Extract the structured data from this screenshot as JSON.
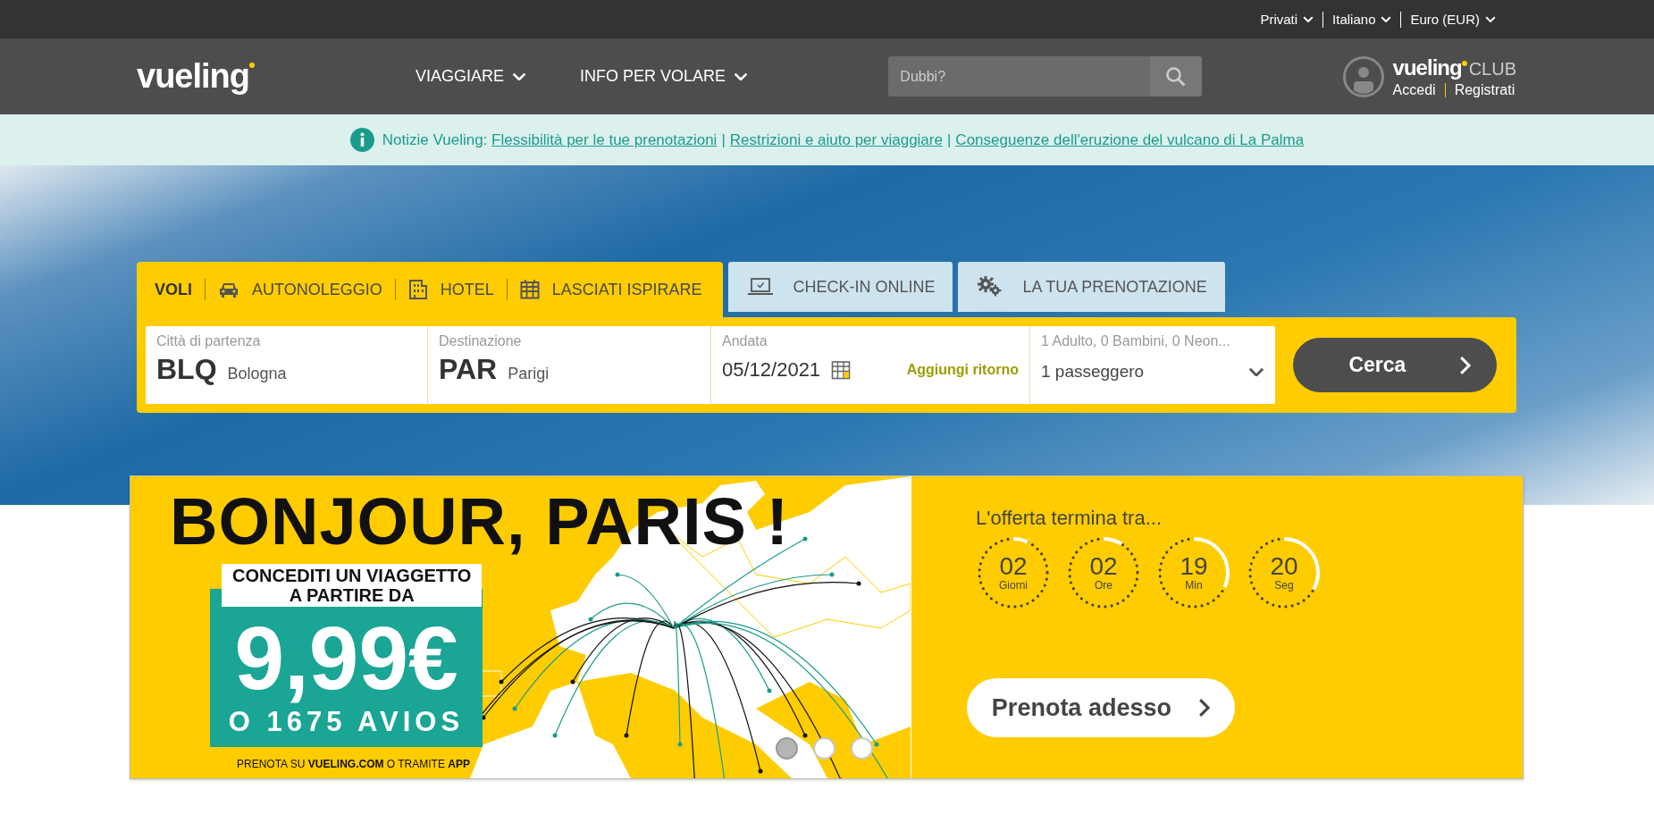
{
  "top_bar": {
    "items": [
      "Privati",
      "Italiano",
      "Euro (EUR)"
    ]
  },
  "header": {
    "logo": "vueling",
    "nav": [
      "VIAGGIARE",
      "INFO PER VOLARE"
    ],
    "search": {
      "placeholder": "Dubbi?"
    },
    "club": {
      "logo": "vueling",
      "label": "CLUB",
      "links": [
        "Accedi",
        "Registrati"
      ]
    }
  },
  "news": {
    "label": "Notizie Vueling:",
    "separator": "|",
    "links": [
      "Flessibilità per le tue prenotazioni",
      "Restrizioni e aiuto per viaggiare",
      "Conseguenze dell'eruzione del vulcano di La Palma"
    ]
  },
  "booking": {
    "tabs": [
      {
        "label": "VOLI",
        "kind": "product",
        "selected": true
      },
      {
        "label": "AUTONOLEGGIO",
        "kind": "product",
        "selected": false
      },
      {
        "label": "HOTEL",
        "kind": "product",
        "selected": false
      },
      {
        "label": "LASCIATI ISPIRARE",
        "kind": "product",
        "selected": false
      },
      {
        "label": "CHECK-IN ONLINE",
        "kind": "manage",
        "selected": false
      },
      {
        "label": "LA TUA PRENOTAZIONE",
        "kind": "manage",
        "selected": false
      }
    ],
    "origin": {
      "label": "Città di partenza",
      "code": "BLQ",
      "city": "Bologna"
    },
    "destination": {
      "label": "Destinazione",
      "code": "PAR",
      "city": "Parigi"
    },
    "departure": {
      "label": "Andata",
      "value": "05/12/2021"
    },
    "add_return": "Aggiungi ritorno",
    "passengers": {
      "label": "1 Adulto, 0 Bambini, 0 Neon...",
      "value": "1 passeggero"
    },
    "search_button": "Cerca"
  },
  "promo": {
    "headline": "BONJOUR, PARIS !",
    "subline": [
      "CONCEDITI UN VIAGGETTO",
      "A PARTIRE DA"
    ],
    "price": "9,99€",
    "avios": "O 1675 AVIOS",
    "footer": "PRENOTA SU **VUELING.COM** O TRAMITE **APP**",
    "carousel": [
      {
        "selected": true
      },
      {
        "selected": false
      },
      {
        "selected": false
      }
    ],
    "countdown": {
      "title": "L'offerta termina tra...",
      "units": [
        {
          "value": "02",
          "label": "Giorni",
          "level": 0.07
        },
        {
          "value": "02",
          "label": "Ore",
          "level": 0.09
        },
        {
          "value": "19",
          "label": "Min",
          "level": 0.32
        },
        {
          "value": "20",
          "label": "Seg",
          "level": 0.33
        }
      ]
    },
    "cta": "Prenota adesso"
  }
}
